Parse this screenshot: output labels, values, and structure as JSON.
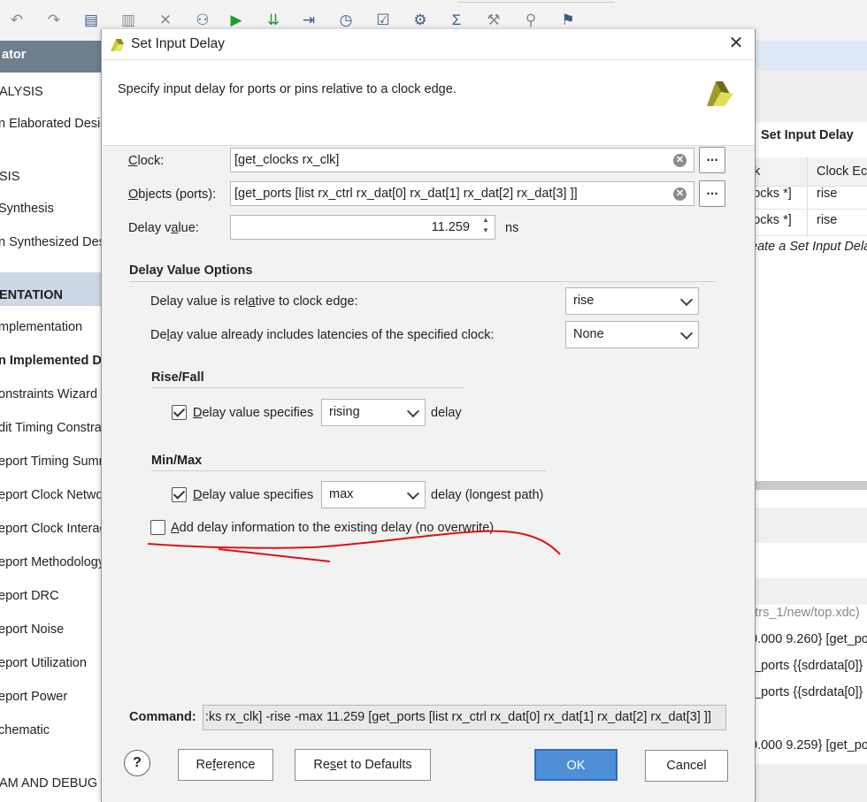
{
  "toolbar": {
    "icons": [
      "undo-icon",
      "redo-icon",
      "copy-icon",
      "paste-icon",
      "delete-icon",
      "find-icon",
      "run-icon",
      "step-icon",
      "run-to-icon",
      "timer-icon",
      "checklist-icon",
      "settings-icon",
      "sum-icon",
      "tool-icon",
      "pin-icon"
    ]
  },
  "flow_navigator": {
    "header": "ator",
    "items": [
      {
        "label": "ALYSIS",
        "kind": "section"
      },
      {
        "label": "n Elaborated Design",
        "kind": "item"
      },
      {
        "label": "SIS",
        "kind": "section"
      },
      {
        "label": "Synthesis",
        "kind": "item"
      },
      {
        "label": "n Synthesized Design",
        "kind": "item"
      },
      {
        "label": "ENTATION",
        "kind": "section-selected"
      },
      {
        "label": "mplementation",
        "kind": "item"
      },
      {
        "label": "n Implemented Design",
        "kind": "bold"
      },
      {
        "label": "onstraints Wizard",
        "kind": "item"
      },
      {
        "label": "dit Timing Constraints",
        "kind": "item"
      },
      {
        "label": "eport Timing Summary",
        "kind": "item"
      },
      {
        "label": "eport Clock Networks",
        "kind": "item"
      },
      {
        "label": "eport Clock Interaction",
        "kind": "item"
      },
      {
        "label": "eport Methodology",
        "kind": "item"
      },
      {
        "label": "eport DRC",
        "kind": "item"
      },
      {
        "label": "eport Noise",
        "kind": "item"
      },
      {
        "label": "eport Utilization",
        "kind": "item"
      },
      {
        "label": "eport Power",
        "kind": "item"
      },
      {
        "label": "chematic",
        "kind": "item"
      },
      {
        "label": "AM AND DEBUG",
        "kind": "section"
      }
    ]
  },
  "right_pane": {
    "title": "Set Input Delay",
    "col1": "k",
    "col2": "Clock Ec",
    "rows": [
      {
        "c1": "locks *]",
        "c2": "rise"
      },
      {
        "c1": "locks *]",
        "c2": "rise"
      }
    ],
    "create_hint": "eate a Set Input Dela",
    "file_path": "strs_1/new/top.xdc)",
    "code_lines": [
      "0.000 9.260} [get_po",
      "t_ports {{sdrdata[0]}",
      "t_ports {{sdrdata[0]}",
      "0.000 9.259} [get_po"
    ]
  },
  "dialog": {
    "title": "Set Input Delay",
    "description": "Specify input delay for ports or pins relative to a clock edge.",
    "clock": {
      "label": "Clock:",
      "value": "[get_clocks rx_clk]"
    },
    "objects": {
      "label": "Objects (ports):",
      "value": "[get_ports [list rx_ctrl rx_dat[0] rx_dat[1] rx_dat[2] rx_dat[3] ]]"
    },
    "delay": {
      "label": "Delay value:",
      "value": "11.259",
      "unit": "ns"
    },
    "more_label": "...",
    "options": {
      "title": "Delay Value Options",
      "relative_label": "Delay value is relative to clock edge:",
      "relative_value": "rise",
      "latency_label": "Delay value already includes latencies of the specified clock:",
      "latency_value": "None"
    },
    "rise_fall": {
      "title": "Rise/Fall",
      "check_label": "Delay value specifies",
      "checked": true,
      "combo_value": "rising",
      "suffix": "delay"
    },
    "min_max": {
      "title": "Min/Max",
      "check_label": "Delay value specifies",
      "checked": true,
      "combo_value": "max",
      "suffix": "delay (longest path)"
    },
    "add_delay": {
      "label": "Add delay information to the existing delay (no overwrite)",
      "checked": false
    },
    "command": {
      "label": "Command:",
      "value": ":ks rx_clk] -rise -max 11.259 [get_ports [list rx_ctrl rx_dat[0] rx_dat[1] rx_dat[2] rx_dat[3] ]]"
    },
    "buttons": {
      "help": "?",
      "reference": "Reference",
      "reset": "Reset to Defaults",
      "ok": "OK",
      "cancel": "Cancel"
    }
  },
  "colors": {
    "accent": "#4f8fd8",
    "annotation": "#e01010",
    "selection": "#cdd8e6",
    "nav_header": "#6f7f8c"
  }
}
